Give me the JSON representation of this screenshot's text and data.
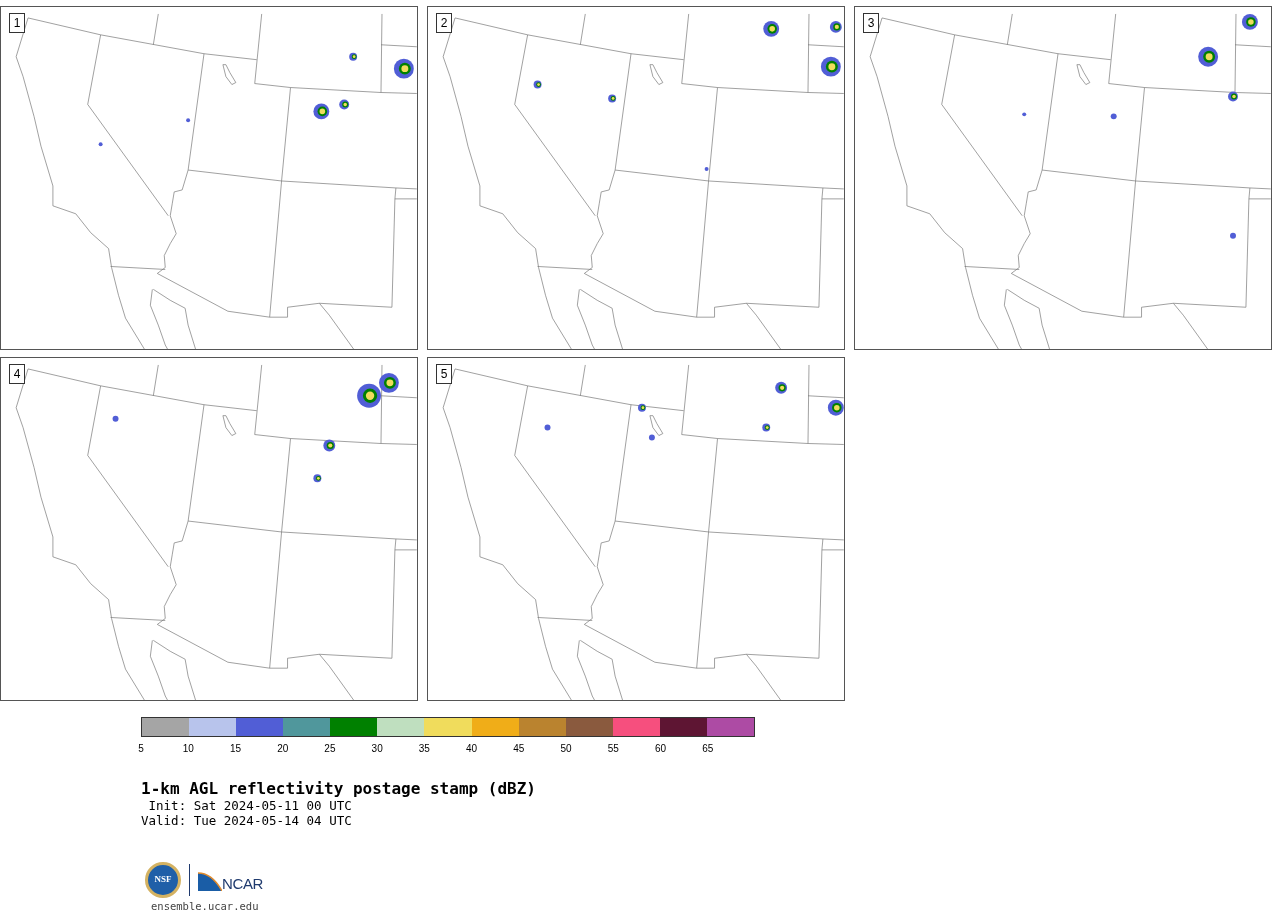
{
  "panels": [
    {
      "label": "1"
    },
    {
      "label": "2"
    },
    {
      "label": "3"
    },
    {
      "label": "4"
    },
    {
      "label": "5"
    }
  ],
  "colorbar": {
    "bins": [
      {
        "label": "5",
        "color": "#a5a5a5"
      },
      {
        "label": "10",
        "color": "#b8c4ec"
      },
      {
        "label": "15",
        "color": "#515ed6"
      },
      {
        "label": "20",
        "color": "#50979c"
      },
      {
        "label": "25",
        "color": "#008000"
      },
      {
        "label": "30",
        "color": "#bfdfbf"
      },
      {
        "label": "35",
        "color": "#f0dc5c"
      },
      {
        "label": "40",
        "color": "#f0ad18"
      },
      {
        "label": "45",
        "color": "#ba832f"
      },
      {
        "label": "50",
        "color": "#8a5a3e"
      },
      {
        "label": "55",
        "color": "#f64f7e"
      },
      {
        "label": "60",
        "color": "#5e1533"
      },
      {
        "label": "65",
        "color": "#ad4ba4"
      }
    ]
  },
  "title": "1-km AGL reflectivity postage stamp (dBZ)",
  "init": " Init: Sat 2024-05-11 00 UTC",
  "valid": "Valid: Tue 2024-05-14 04 UTC",
  "logos": {
    "nsf": "NSF",
    "ncar": "NCAR"
  },
  "url": "ensemble.ucar.edu"
}
